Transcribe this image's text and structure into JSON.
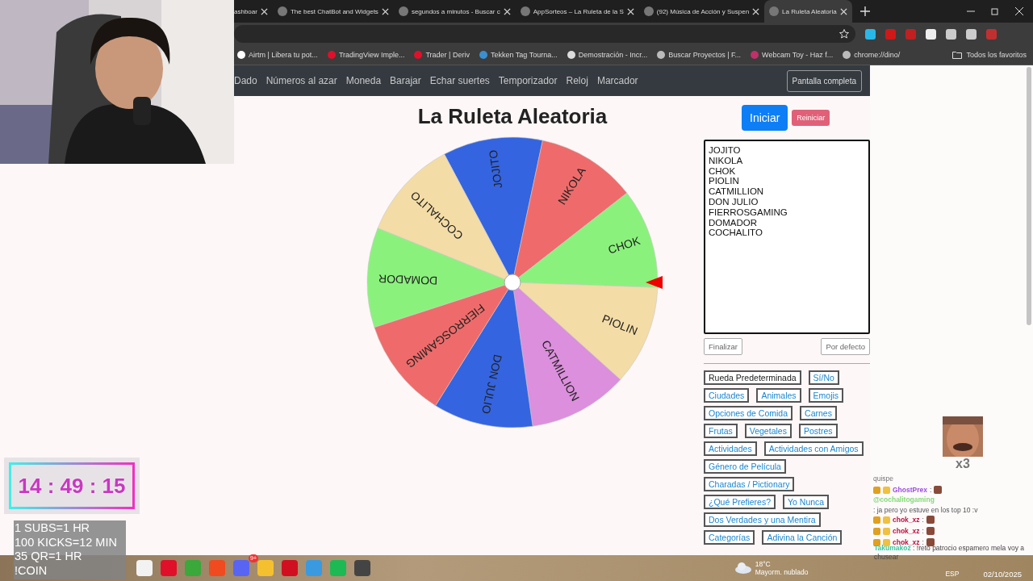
{
  "tabs": [
    {
      "title": "ashboar",
      "selected": false
    },
    {
      "title": "The best ChatBot and Widgets",
      "selected": false
    },
    {
      "title": "segundos a minutos - Buscar c",
      "selected": false
    },
    {
      "title": "AppSorteos – La Ruleta de la S",
      "selected": false
    },
    {
      "title": "(92) Música de Acción y Suspen",
      "selected": false
    },
    {
      "title": "La Ruleta Aleatoria",
      "selected": true
    }
  ],
  "bookmarks": [
    {
      "label": "Airtm | Libera tu pot...",
      "color": "#ffffff"
    },
    {
      "label": "TradingView Imple...",
      "color": "#e0102a"
    },
    {
      "label": "Trader | Deriv",
      "color": "#e0102a"
    },
    {
      "label": "Tekken Tag Tourna...",
      "color": "#3a8fd0"
    },
    {
      "label": "Demostración - Incr...",
      "color": "#dddddd"
    },
    {
      "label": "Buscar Proyectos | F...",
      "color": "#bbbbbb"
    },
    {
      "label": "Webcam Toy - Haz f...",
      "color": "#c0306a"
    },
    {
      "label": "chrome://dino/",
      "color": "#bbbbbb"
    }
  ],
  "all_bookmarks": "Todos los favoritos",
  "nav": {
    "items": [
      "Dado",
      "Números al azar",
      "Moneda",
      "Barajar",
      "Echar suertes",
      "Temporizador",
      "Reloj",
      "Marcador"
    ],
    "fullscreen_button": "Pantalla completa"
  },
  "title": "La Ruleta Aleatoria",
  "wheel": {
    "segments": [
      {
        "name": "JOJITO",
        "color": "#3464e0"
      },
      {
        "name": "NIKOLA",
        "color": "#ef6b6b"
      },
      {
        "name": "CHOK",
        "color": "#8af27c"
      },
      {
        "name": "PIOLIN",
        "color": "#f4dca6"
      },
      {
        "name": "CATMILLION",
        "color": "#dc8fdc"
      },
      {
        "name": "DON JULIO",
        "color": "#3464e0"
      },
      {
        "name": "FIERROSGAMING",
        "color": "#ef6b6b"
      },
      {
        "name": "DOMADOR",
        "color": "#8af27c"
      },
      {
        "name": "COCHALITO",
        "color": "#f4dca6"
      }
    ]
  },
  "start_button": "Iniciar",
  "reset_button": "Reiniciar",
  "names_field": {
    "value": "JOJITO\nNIKOLA\nCHOK\nPIOLIN\nCATMILLION\nDON JULIO\nFIERROSGAMING\nDOMADOR\nCOCHALITO"
  },
  "finish_button": "Finalizar",
  "default_button": "Por defecto",
  "presets": [
    {
      "label": "Rueda Predeterminada",
      "selected": true
    },
    {
      "label": "Sí/No",
      "selected": false
    },
    {
      "label": "Ciudades",
      "selected": false
    },
    {
      "label": "Animales",
      "selected": false
    },
    {
      "label": "Emojis",
      "selected": false
    },
    {
      "label": "Opciones de Comida",
      "selected": false
    },
    {
      "label": "Carnes",
      "selected": false
    },
    {
      "label": "Frutas",
      "selected": false
    },
    {
      "label": "Vegetales",
      "selected": false
    },
    {
      "label": "Postres",
      "selected": false
    },
    {
      "label": "Actividades",
      "selected": false
    },
    {
      "label": "Actividades con Amigos",
      "selected": false
    },
    {
      "label": "Género de Película",
      "selected": false
    },
    {
      "label": "Charadas / Pictionary",
      "selected": false
    },
    {
      "label": "¿Qué Prefieres?",
      "selected": false
    },
    {
      "label": "Yo Nunca",
      "selected": false
    },
    {
      "label": "Dos Verdades y una Mentira",
      "selected": false
    },
    {
      "label": "Categorías",
      "selected": false
    },
    {
      "label": "Adivina la Canción",
      "selected": false
    }
  ],
  "overlay": {
    "timer": "14 : 49 : 15",
    "goals": [
      "1 SUBS=1 HR",
      "100 KICKS=12 MIN",
      "35 QR=1 HR",
      "!COIN"
    ],
    "chat": {
      "emote_count": "x3",
      "messages": [
        {
          "kind": "plain",
          "text": "quispe"
        },
        {
          "kind": "user",
          "user": "GhostPrex",
          "color": "#9a4fe0",
          "text": ":",
          "emote": true
        },
        {
          "kind": "user",
          "user": "@cochalitogaming",
          "color": "#86d97a",
          "text": ": ja pero yo estuve en los top 10 :v",
          "emote": false
        },
        {
          "kind": "user",
          "user": "chok_xz",
          "color": "#c01040",
          "text": ":",
          "emote": true
        },
        {
          "kind": "user",
          "user": "chok_xz",
          "color": "#c01040",
          "text": ":",
          "emote": true
        },
        {
          "kind": "user",
          "user": "chok_xz",
          "color": "#c01040",
          "text": ":",
          "emote": true
        }
      ],
      "last": {
        "user": "Takumakoz",
        "color": "#3cc8a0",
        "text": ": !reto patrocio espamero mela voy a chusear"
      }
    }
  },
  "taskbar": {
    "notification_badge": "9+",
    "weather": {
      "temp": "18°C",
      "condition": "Mayorm. nublado"
    },
    "language": "ESP",
    "date": "02/10/2025"
  }
}
